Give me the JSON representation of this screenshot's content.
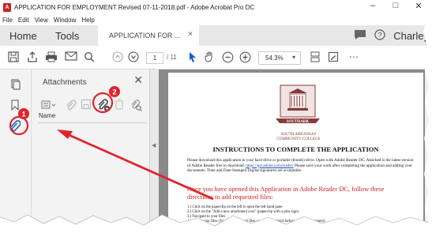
{
  "window": {
    "title": "APPLICATION FOR EMPLOYMENT Revised 07-11-2018.pdf - Adobe Acrobat Pro DC",
    "minimize_glyph": "–",
    "maximize_glyph": "□",
    "close_glyph": "✕"
  },
  "menu": [
    "File",
    "Edit",
    "View",
    "Window",
    "Help"
  ],
  "tabs": {
    "home": "Home",
    "tools": "Tools",
    "document": "APPLICATION FOR ...",
    "close_glyph": "×",
    "user": "Charley"
  },
  "toolbar": {
    "page_current": "1",
    "page_total": "/ 11",
    "zoom": "54.3%"
  },
  "attachments": {
    "title": "Attachments",
    "close_glyph": "✕",
    "column_header": "Name"
  },
  "annotations": {
    "badge_1": "1",
    "badge_2": "2",
    "accent_color": "#e0242c"
  },
  "document": {
    "logo_text": "SOUTHARK",
    "logo_caption_1": "SOUTH ARKANSAS",
    "logo_caption_2": "COMMUNITY COLLEGE",
    "heading": "INSTRUCTIONS TO COMPLETE THE APPLICATION",
    "para_1": "Please download this application to your hard drive or portable (thumb) drive. Open with Adobe Reader DC. Attached is the latest version of Adobe Reader free to download.",
    "para_link": "https://get.adobe.com/reader/",
    "para_2": "Please save your work after completing the application and adding your documents. Time and Date Stamped Digital signatures are acceptable.",
    "red_instruction": "Once you have opened this Application in Adobe Reader DC, follow these directions to add requested files:",
    "steps": [
      "1.) Click on the paperclip on the left to open the left hand pane",
      "2.) Click on the \"Add a new attachment icon\" (paperclip with a plus sign)",
      "3.) Navigate to your files",
      "4.) Attach your files (You may attach all files you wish to attach before opening document)"
    ]
  }
}
